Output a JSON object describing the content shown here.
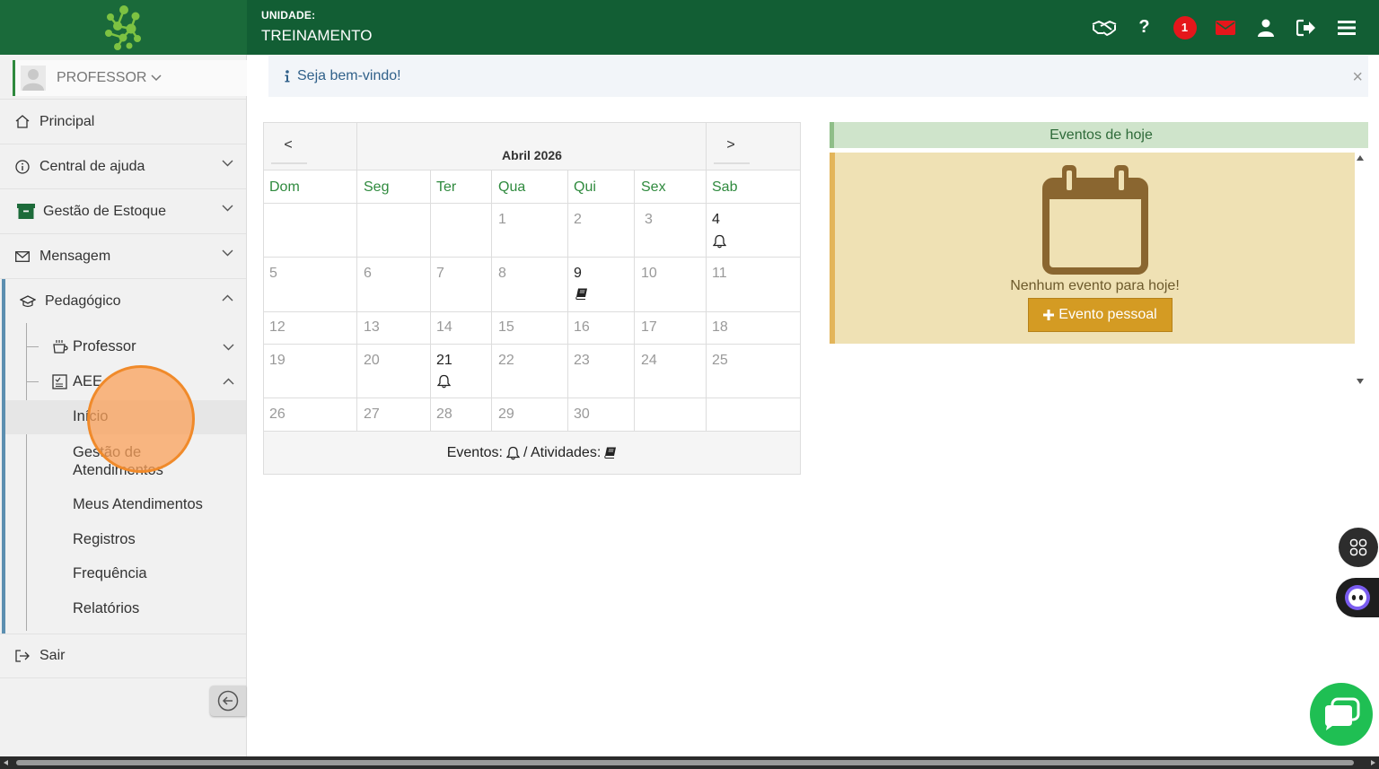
{
  "header": {
    "unit_label": "UNIDADE:",
    "unit_name": "TREINAMENTO",
    "notification_count": "1",
    "icons": [
      "handshake-icon",
      "help-icon",
      "notification-badge",
      "mail-icon",
      "user-icon",
      "logout-icon",
      "hamburger-menu-icon"
    ]
  },
  "sidebar": {
    "profile_name": "PROFESSOR",
    "items": {
      "principal": "Principal",
      "central": "Central de ajuda",
      "estoque": "Gestão de Estoque",
      "mensagem": "Mensagem",
      "pedagogico": "Pedagógico",
      "sair": "Sair"
    },
    "pedagogico_children": {
      "professor": "Professor",
      "aee": "AEE"
    },
    "aee_children": {
      "inicio": "Início",
      "gestao_line1": "Gestão de",
      "gestao_line2": "Atendimentos",
      "meus": "Meus Atendimentos",
      "registros": "Registros",
      "frequencia": "Frequência",
      "relatorios": "Relatórios"
    }
  },
  "welcome": {
    "message": "Seja bem-vindo!",
    "close": "×"
  },
  "calendar": {
    "prev": "<",
    "next": ">",
    "month": "Abril 2026",
    "weekdays": [
      "Dom",
      "Seg",
      "Ter",
      "Qua",
      "Qui",
      "Sex",
      "Sab"
    ],
    "weeks": [
      [
        "",
        "",
        "",
        "1",
        "2",
        "3",
        "4"
      ],
      [
        "5",
        "6",
        "7",
        "8",
        "9",
        "10",
        "11"
      ],
      [
        "12",
        "13",
        "14",
        "15",
        "16",
        "17",
        "18"
      ],
      [
        "19",
        "20",
        "21",
        "22",
        "23",
        "24",
        "25"
      ],
      [
        "26",
        "27",
        "28",
        "29",
        "30",
        "",
        ""
      ]
    ],
    "event_days": [
      "4",
      "21"
    ],
    "activity_days": [
      "9"
    ],
    "footer_events": "Eventos:",
    "footer_activities": "/ Atividades:"
  },
  "events_today": {
    "title": "Eventos de hoje",
    "empty_text": "Nenhum evento para hoje!",
    "add_button": "Evento pessoal"
  },
  "colors": {
    "header_green": "#125e34",
    "accent_green": "#2f8a3e",
    "badge_red": "#e5161b",
    "event_button": "#d49b23"
  }
}
